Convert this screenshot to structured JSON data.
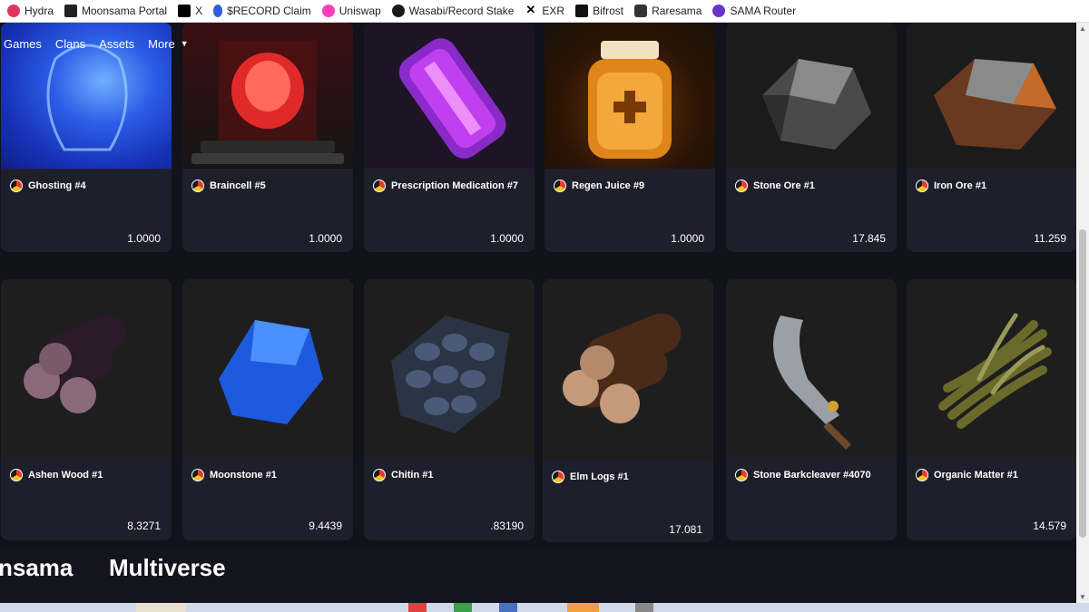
{
  "bookmarks": [
    {
      "label": "Hydra",
      "icon": "hydra-icon"
    },
    {
      "label": "Moonsama Portal",
      "icon": "moonsama-icon"
    },
    {
      "label": "X",
      "icon": "x-icon"
    },
    {
      "label": "$RECORD Claim",
      "icon": "record-icon"
    },
    {
      "label": "Uniswap",
      "icon": "uniswap-icon"
    },
    {
      "label": "Wasabi/Record Stake",
      "icon": "wasabi-icon"
    },
    {
      "label": "EXR",
      "icon": "exr-icon"
    },
    {
      "label": "Bifrost",
      "icon": "bifrost-icon"
    },
    {
      "label": "Raresama",
      "icon": "raresama-icon"
    },
    {
      "label": "SAMA Router",
      "icon": "sama-router-icon"
    }
  ],
  "nav": {
    "games": "Games",
    "clans": "Clans",
    "assets": "Assets",
    "more": "More"
  },
  "assets_row1": [
    {
      "name": "Ghosting #4",
      "qty": "1.0000"
    },
    {
      "name": "Braincell #5",
      "qty": "1.0000"
    },
    {
      "name": "Prescription Medication #7",
      "qty": "1.0000"
    },
    {
      "name": "Regen Juice #9",
      "qty": "1.0000"
    },
    {
      "name": "Stone Ore #1",
      "qty": "17.845"
    },
    {
      "name": "Iron Ore #1",
      "qty": "11.259"
    }
  ],
  "assets_row2": [
    {
      "name": "Ashen Wood #1",
      "qty": "8.3271"
    },
    {
      "name": "Moonstone #1",
      "qty": "9.4439"
    },
    {
      "name": "Chitin #1",
      "qty": ".83190"
    },
    {
      "name": "Elm Logs #1",
      "qty": "17.081"
    },
    {
      "name": "Stone Barkcleaver #4070",
      "qty": ""
    },
    {
      "name": "Organic Matter #1",
      "qty": "14.579"
    }
  ],
  "footer": {
    "left_title": "nsama",
    "right_title": "Multiverse"
  },
  "colors": {
    "page_bg": "#14141f",
    "card_bg": "#1f1f2c",
    "accent_purple": "#9b3bd8",
    "flag_red": "#e63b2e",
    "flag_yellow": "#f3c320"
  }
}
